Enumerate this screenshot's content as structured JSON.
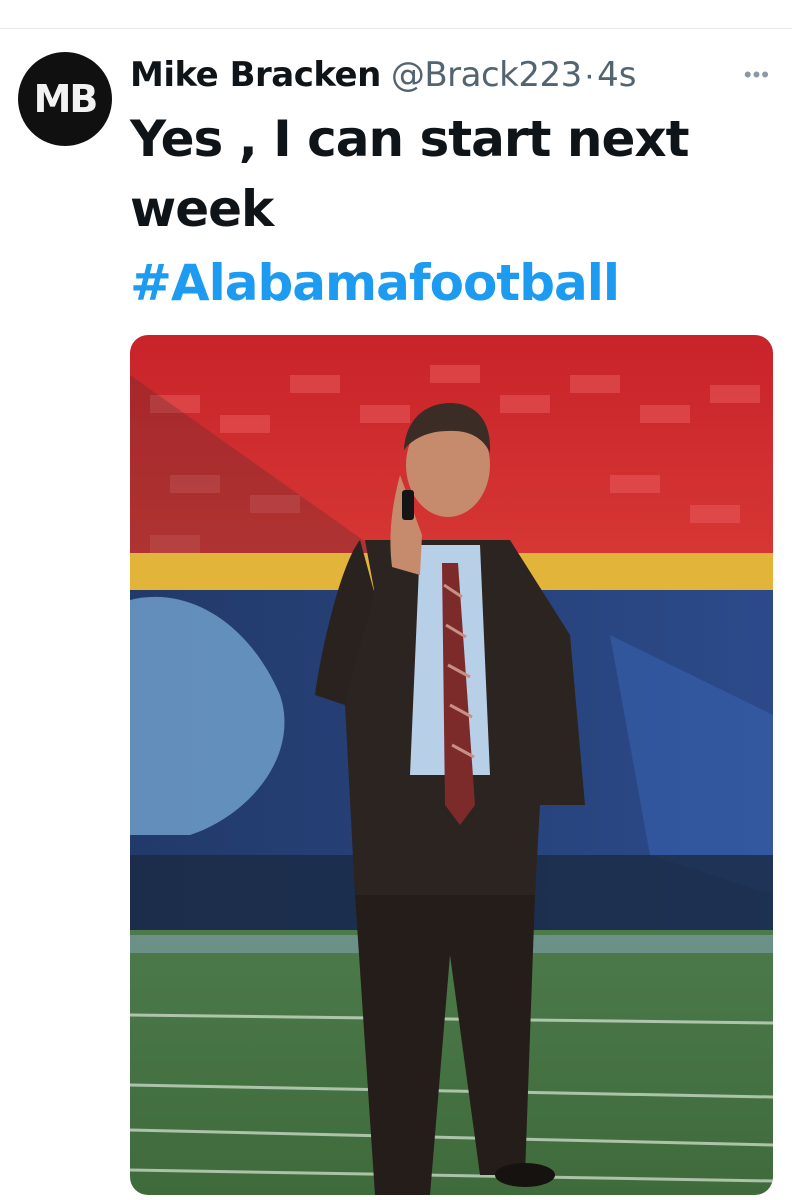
{
  "tweet": {
    "author": {
      "avatar_initials": "MB",
      "display_name": "Mike Bracken",
      "handle": "@Brack223",
      "separator": "·",
      "timestamp": "4s"
    },
    "more_icon": "more-horizontal-icon",
    "text": "Yes , I can start next week",
    "hashtag": "#Alabamafootball",
    "media": {
      "type": "photo",
      "alt": ""
    }
  },
  "colors": {
    "text_primary": "#0f1419",
    "text_secondary": "#536471",
    "link": "#1d9bf0",
    "avatar_bg": "#101010"
  }
}
